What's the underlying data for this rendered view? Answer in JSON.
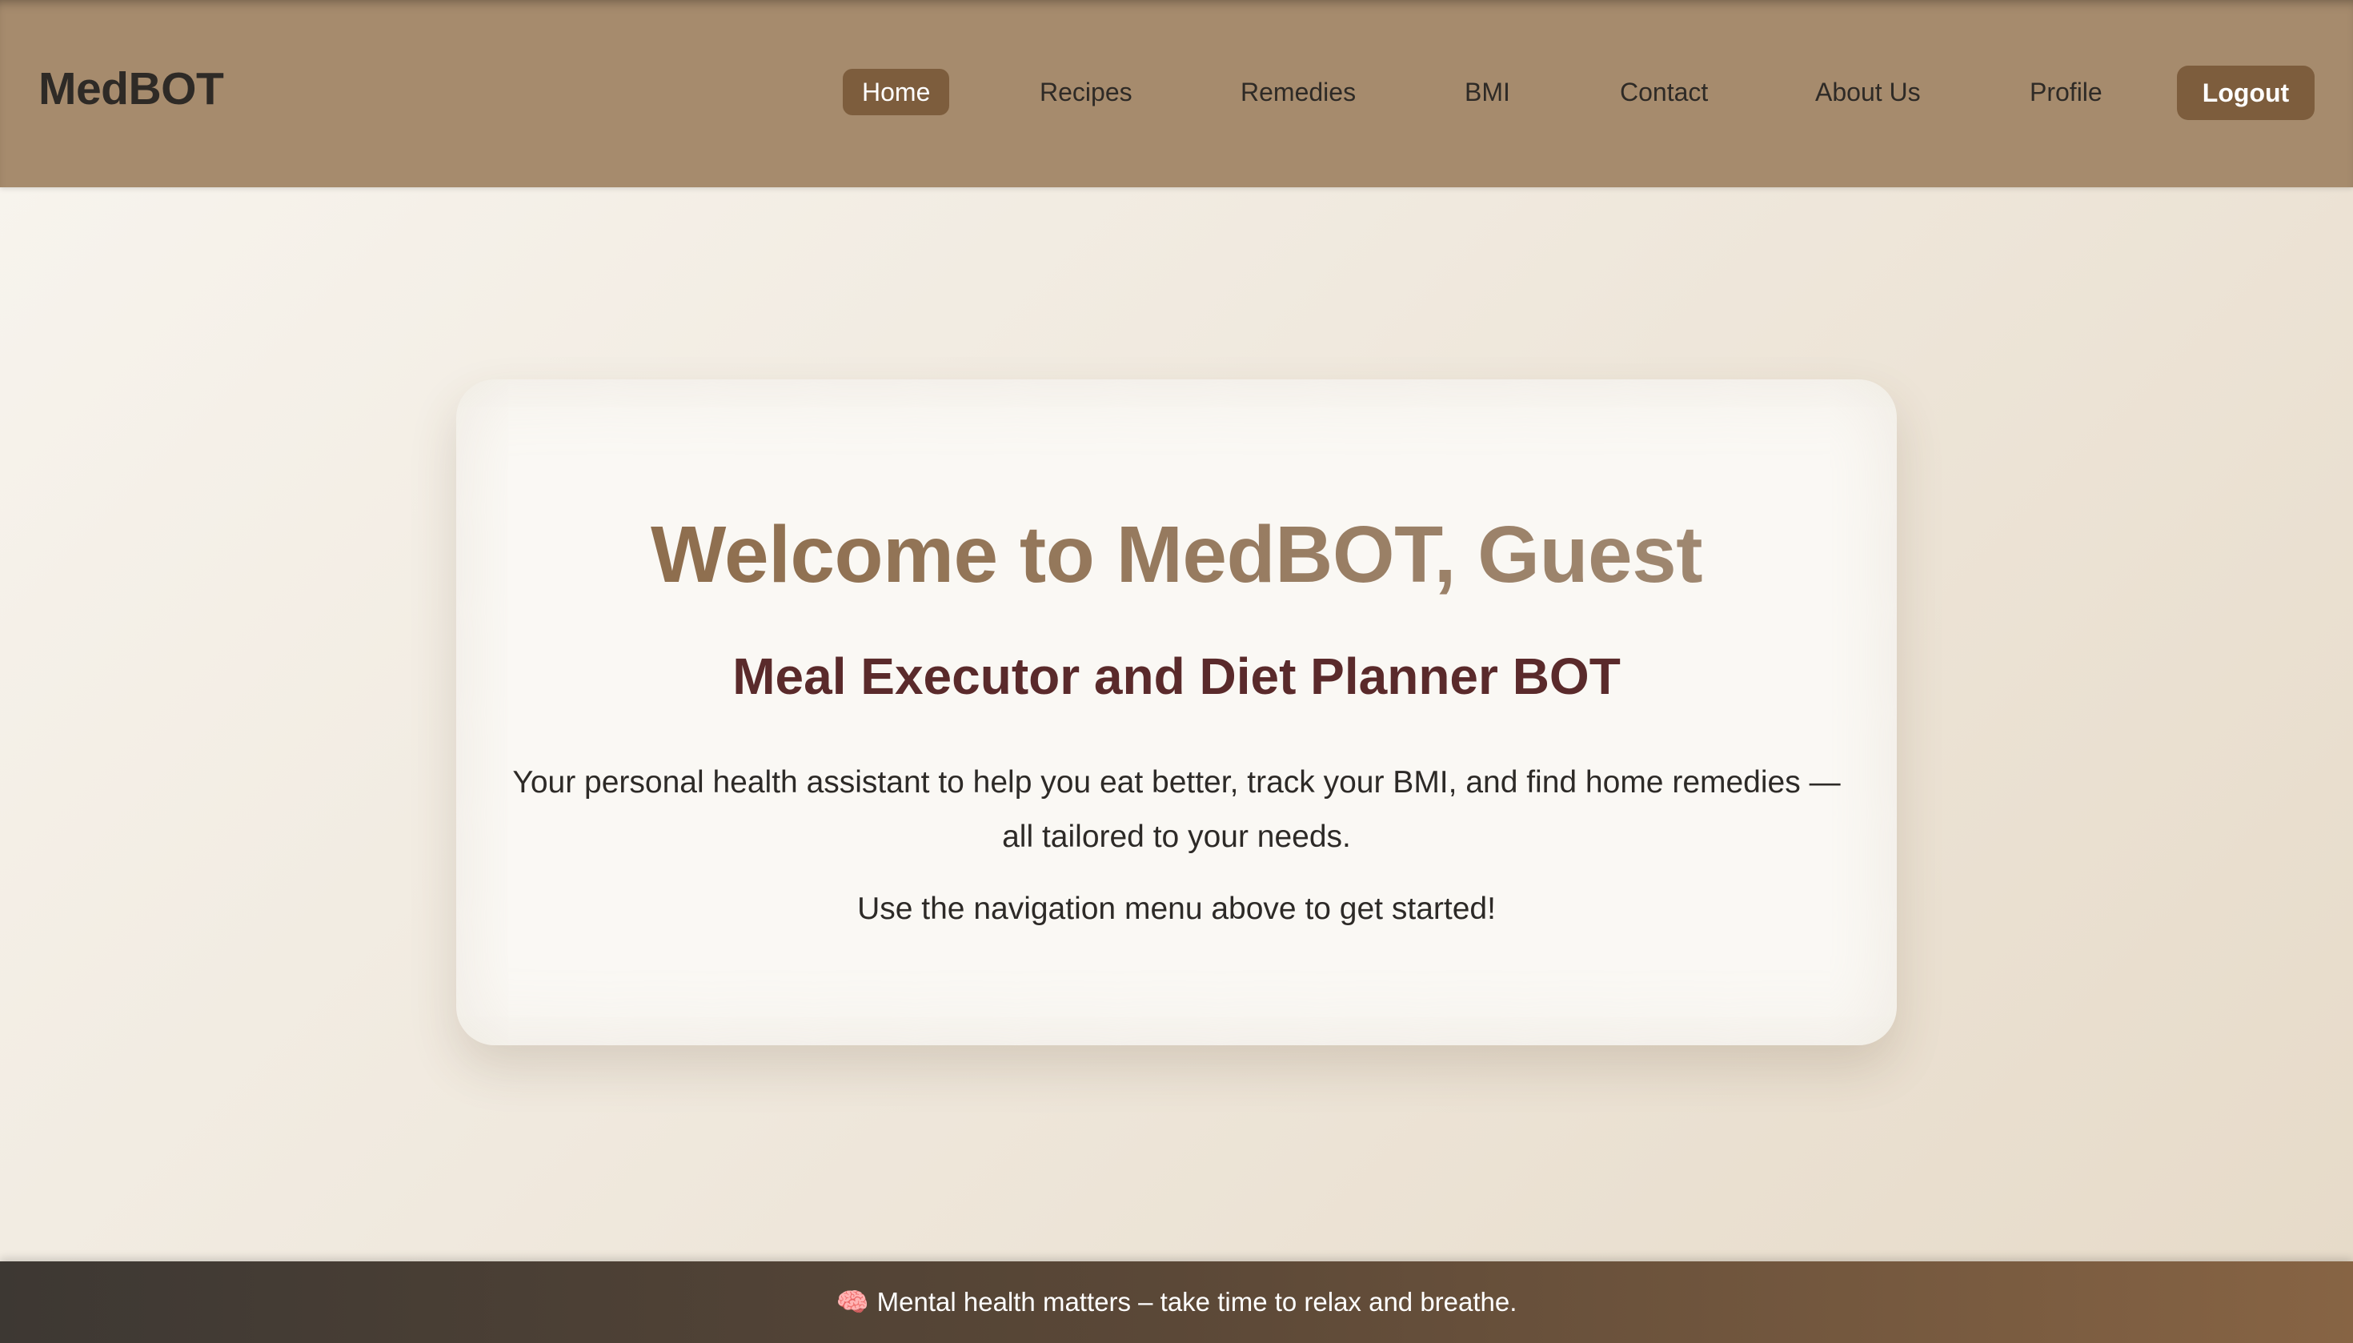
{
  "navbar": {
    "brand": "MedBOT",
    "links": [
      {
        "label": "Home",
        "active": true
      },
      {
        "label": "Recipes",
        "active": false
      },
      {
        "label": "Remedies",
        "active": false
      },
      {
        "label": "BMI",
        "active": false
      },
      {
        "label": "Contact",
        "active": false
      },
      {
        "label": "About Us",
        "active": false
      },
      {
        "label": "Profile",
        "active": false
      }
    ],
    "logout_label": "Logout"
  },
  "hero": {
    "title": "Welcome to MedBOT, Guest",
    "subtitle": "Meal Executor and Diet Planner BOT",
    "description": "Your personal health assistant to help you eat better, track your BMI, and find home remedies — all tailored to your needs.",
    "cta": "Use the navigation menu above to get started!"
  },
  "footer": {
    "icon": "🧠",
    "message": "Mental health matters – take time to relax and breathe."
  },
  "colors": {
    "navbar_bg": "#a68b6d",
    "accent": "#7d5d3d",
    "subtitle": "#5a2a2b",
    "text": "#2d2a27"
  }
}
